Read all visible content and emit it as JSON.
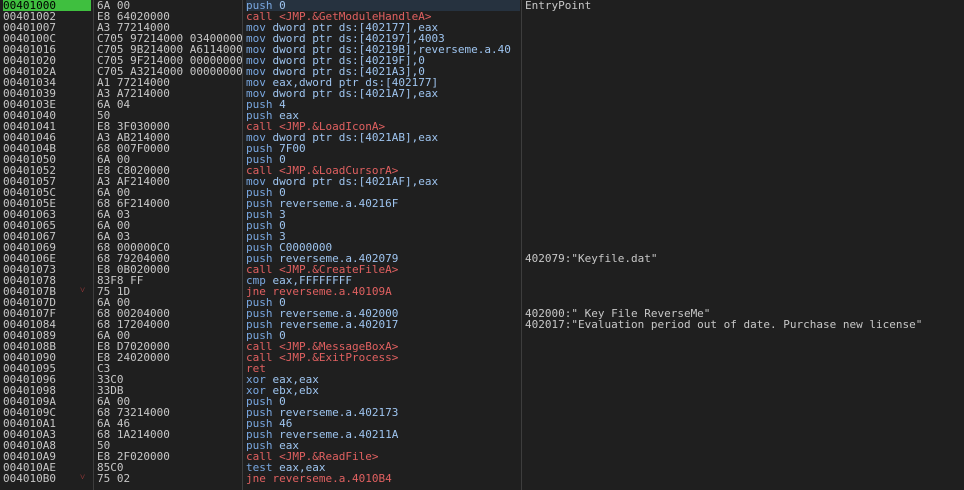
{
  "rows": [
    {
      "addr": "00401000",
      "arrow": "",
      "bytes": "6A 00",
      "mnem": "push",
      "ops": "0",
      "comment": "EntryPoint",
      "kind": "other",
      "selected": true
    },
    {
      "addr": "00401002",
      "arrow": "",
      "bytes": "E8 64020000",
      "mnem": "call",
      "ops": "<JMP.&GetModuleHandleA>",
      "comment": "",
      "kind": "call"
    },
    {
      "addr": "00401007",
      "arrow": "",
      "bytes": "A3 77214000",
      "mnem": "mov",
      "ops": "dword ptr ds:[402177],eax",
      "comment": "",
      "kind": "other"
    },
    {
      "addr": "0040100C",
      "arrow": "",
      "bytes": "C705 97214000 03400000",
      "mnem": "mov",
      "ops": "dword ptr ds:[402197],4003",
      "comment": "",
      "kind": "other"
    },
    {
      "addr": "00401016",
      "arrow": "",
      "bytes": "C705 9B214000 A6114000",
      "mnem": "mov",
      "ops": "dword ptr ds:[40219B],reverseme.a.40",
      "comment": "",
      "kind": "other"
    },
    {
      "addr": "00401020",
      "arrow": "",
      "bytes": "C705 9F214000 00000000",
      "mnem": "mov",
      "ops": "dword ptr ds:[40219F],0",
      "comment": "",
      "kind": "other"
    },
    {
      "addr": "0040102A",
      "arrow": "",
      "bytes": "C705 A3214000 00000000",
      "mnem": "mov",
      "ops": "dword ptr ds:[4021A3],0",
      "comment": "",
      "kind": "other"
    },
    {
      "addr": "00401034",
      "arrow": "",
      "bytes": "A1 77214000",
      "mnem": "mov",
      "ops": "eax,dword ptr ds:[402177]",
      "comment": "",
      "kind": "other"
    },
    {
      "addr": "00401039",
      "arrow": "",
      "bytes": "A3 A7214000",
      "mnem": "mov",
      "ops": "dword ptr ds:[4021A7],eax",
      "comment": "",
      "kind": "other"
    },
    {
      "addr": "0040103E",
      "arrow": "",
      "bytes": "6A 04",
      "mnem": "push",
      "ops": "4",
      "comment": "",
      "kind": "other"
    },
    {
      "addr": "00401040",
      "arrow": "",
      "bytes": "50",
      "mnem": "push",
      "ops": "eax",
      "comment": "",
      "kind": "other"
    },
    {
      "addr": "00401041",
      "arrow": "",
      "bytes": "E8 3F030000",
      "mnem": "call",
      "ops": "<JMP.&LoadIconA>",
      "comment": "",
      "kind": "call"
    },
    {
      "addr": "00401046",
      "arrow": "",
      "bytes": "A3 AB214000",
      "mnem": "mov",
      "ops": "dword ptr ds:[4021AB],eax",
      "comment": "",
      "kind": "other"
    },
    {
      "addr": "0040104B",
      "arrow": "",
      "bytes": "68 007F0000",
      "mnem": "push",
      "ops": "7F00",
      "comment": "",
      "kind": "other"
    },
    {
      "addr": "00401050",
      "arrow": "",
      "bytes": "6A 00",
      "mnem": "push",
      "ops": "0",
      "comment": "",
      "kind": "other"
    },
    {
      "addr": "00401052",
      "arrow": "",
      "bytes": "E8 C8020000",
      "mnem": "call",
      "ops": "<JMP.&LoadCursorA>",
      "comment": "",
      "kind": "call"
    },
    {
      "addr": "00401057",
      "arrow": "",
      "bytes": "A3 AF214000",
      "mnem": "mov",
      "ops": "dword ptr ds:[4021AF],eax",
      "comment": "",
      "kind": "other"
    },
    {
      "addr": "0040105C",
      "arrow": "",
      "bytes": "6A 00",
      "mnem": "push",
      "ops": "0",
      "comment": "",
      "kind": "other"
    },
    {
      "addr": "0040105E",
      "arrow": "",
      "bytes": "68 6F214000",
      "mnem": "push",
      "ops": "reverseme.a.40216F",
      "comment": "",
      "kind": "other"
    },
    {
      "addr": "00401063",
      "arrow": "",
      "bytes": "6A 03",
      "mnem": "push",
      "ops": "3",
      "comment": "",
      "kind": "other"
    },
    {
      "addr": "00401065",
      "arrow": "",
      "bytes": "6A 00",
      "mnem": "push",
      "ops": "0",
      "comment": "",
      "kind": "other"
    },
    {
      "addr": "00401067",
      "arrow": "",
      "bytes": "6A 03",
      "mnem": "push",
      "ops": "3",
      "comment": "",
      "kind": "other"
    },
    {
      "addr": "00401069",
      "arrow": "",
      "bytes": "68 000000C0",
      "mnem": "push",
      "ops": "C0000000",
      "comment": "",
      "kind": "other"
    },
    {
      "addr": "0040106E",
      "arrow": "",
      "bytes": "68 79204000",
      "mnem": "push",
      "ops": "reverseme.a.402079",
      "comment": "402079:\"Keyfile.dat\"",
      "kind": "other"
    },
    {
      "addr": "00401073",
      "arrow": "",
      "bytes": "E8 0B020000",
      "mnem": "call",
      "ops": "<JMP.&CreateFileA>",
      "comment": "",
      "kind": "call"
    },
    {
      "addr": "00401078",
      "arrow": "",
      "bytes": "83F8 FF",
      "mnem": "cmp",
      "ops": "eax,FFFFFFFF",
      "comment": "",
      "kind": "other"
    },
    {
      "addr": "0040107B",
      "arrow": "˅",
      "bytes": "75 1D",
      "mnem": "jne",
      "ops": "reverseme.a.40109A",
      "comment": "",
      "kind": "jmp"
    },
    {
      "addr": "0040107D",
      "arrow": "",
      "bytes": "6A 00",
      "mnem": "push",
      "ops": "0",
      "comment": "",
      "kind": "other"
    },
    {
      "addr": "0040107F",
      "arrow": "",
      "bytes": "68 00204000",
      "mnem": "push",
      "ops": "reverseme.a.402000",
      "comment": "402000:\" Key File ReverseMe\"",
      "kind": "other"
    },
    {
      "addr": "00401084",
      "arrow": "",
      "bytes": "68 17204000",
      "mnem": "push",
      "ops": "reverseme.a.402017",
      "comment": "402017:\"Evaluation period out of date. Purchase new license\"",
      "kind": "other"
    },
    {
      "addr": "00401089",
      "arrow": "",
      "bytes": "6A 00",
      "mnem": "push",
      "ops": "0",
      "comment": "",
      "kind": "other"
    },
    {
      "addr": "0040108B",
      "arrow": "",
      "bytes": "E8 D7020000",
      "mnem": "call",
      "ops": "<JMP.&MessageBoxA>",
      "comment": "",
      "kind": "call"
    },
    {
      "addr": "00401090",
      "arrow": "",
      "bytes": "E8 24020000",
      "mnem": "call",
      "ops": "<JMP.&ExitProcess>",
      "comment": "",
      "kind": "call"
    },
    {
      "addr": "00401095",
      "arrow": "",
      "bytes": "C3",
      "mnem": "ret",
      "ops": "",
      "comment": "",
      "kind": "ret"
    },
    {
      "addr": "00401096",
      "arrow": "",
      "bytes": "33C0",
      "mnem": "xor",
      "ops": "eax,eax",
      "comment": "",
      "kind": "other"
    },
    {
      "addr": "00401098",
      "arrow": "",
      "bytes": "33DB",
      "mnem": "xor",
      "ops": "ebx,ebx",
      "comment": "",
      "kind": "other"
    },
    {
      "addr": "0040109A",
      "arrow": "",
      "bytes": "6A 00",
      "mnem": "push",
      "ops": "0",
      "comment": "",
      "kind": "other"
    },
    {
      "addr": "0040109C",
      "arrow": "",
      "bytes": "68 73214000",
      "mnem": "push",
      "ops": "reverseme.a.402173",
      "comment": "",
      "kind": "other"
    },
    {
      "addr": "004010A1",
      "arrow": "",
      "bytes": "6A 46",
      "mnem": "push",
      "ops": "46",
      "comment": "",
      "kind": "other"
    },
    {
      "addr": "004010A3",
      "arrow": "",
      "bytes": "68 1A214000",
      "mnem": "push",
      "ops": "reverseme.a.40211A",
      "comment": "",
      "kind": "other"
    },
    {
      "addr": "004010A8",
      "arrow": "",
      "bytes": "50",
      "mnem": "push",
      "ops": "eax",
      "comment": "",
      "kind": "other"
    },
    {
      "addr": "004010A9",
      "arrow": "",
      "bytes": "E8 2F020000",
      "mnem": "call",
      "ops": "<JMP.&ReadFile>",
      "comment": "",
      "kind": "call"
    },
    {
      "addr": "004010AE",
      "arrow": "",
      "bytes": "85C0",
      "mnem": "test",
      "ops": "eax,eax",
      "comment": "",
      "kind": "other"
    },
    {
      "addr": "004010B0",
      "arrow": "˅",
      "bytes": "75 02",
      "mnem": "jne",
      "ops": "reverseme.a.4010B4",
      "comment": "",
      "kind": "jmp"
    }
  ]
}
